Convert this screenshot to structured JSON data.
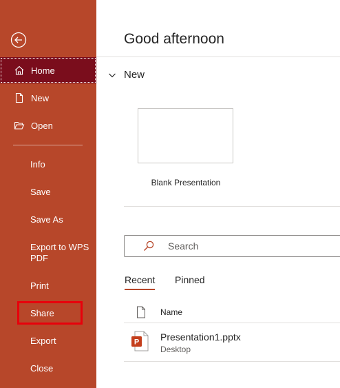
{
  "sidebar": {
    "back_label": "Back",
    "items": [
      {
        "label": "Home"
      },
      {
        "label": "New"
      },
      {
        "label": "Open"
      },
      {
        "label": "Info"
      },
      {
        "label": "Save"
      },
      {
        "label": "Save As"
      },
      {
        "label": "Export to WPS PDF"
      },
      {
        "label": "Print"
      },
      {
        "label": "Share"
      },
      {
        "label": "Export"
      },
      {
        "label": "Close"
      }
    ],
    "export_line1": "Export to WPS",
    "export_line2": "PDF"
  },
  "header": {
    "greeting": "Good afternoon"
  },
  "new_section": {
    "title": "New",
    "templates": [
      {
        "label": "Blank Presentation"
      }
    ]
  },
  "search": {
    "placeholder": "Search"
  },
  "tabs": [
    {
      "label": "Recent"
    },
    {
      "label": "Pinned"
    }
  ],
  "files": {
    "column_name": "Name",
    "rows": [
      {
        "name": "Presentation1.pptx",
        "location": "Desktop"
      }
    ]
  },
  "colors": {
    "accent": "#b7472a",
    "active": "#7a0d1c",
    "highlight": "#e8000b"
  }
}
